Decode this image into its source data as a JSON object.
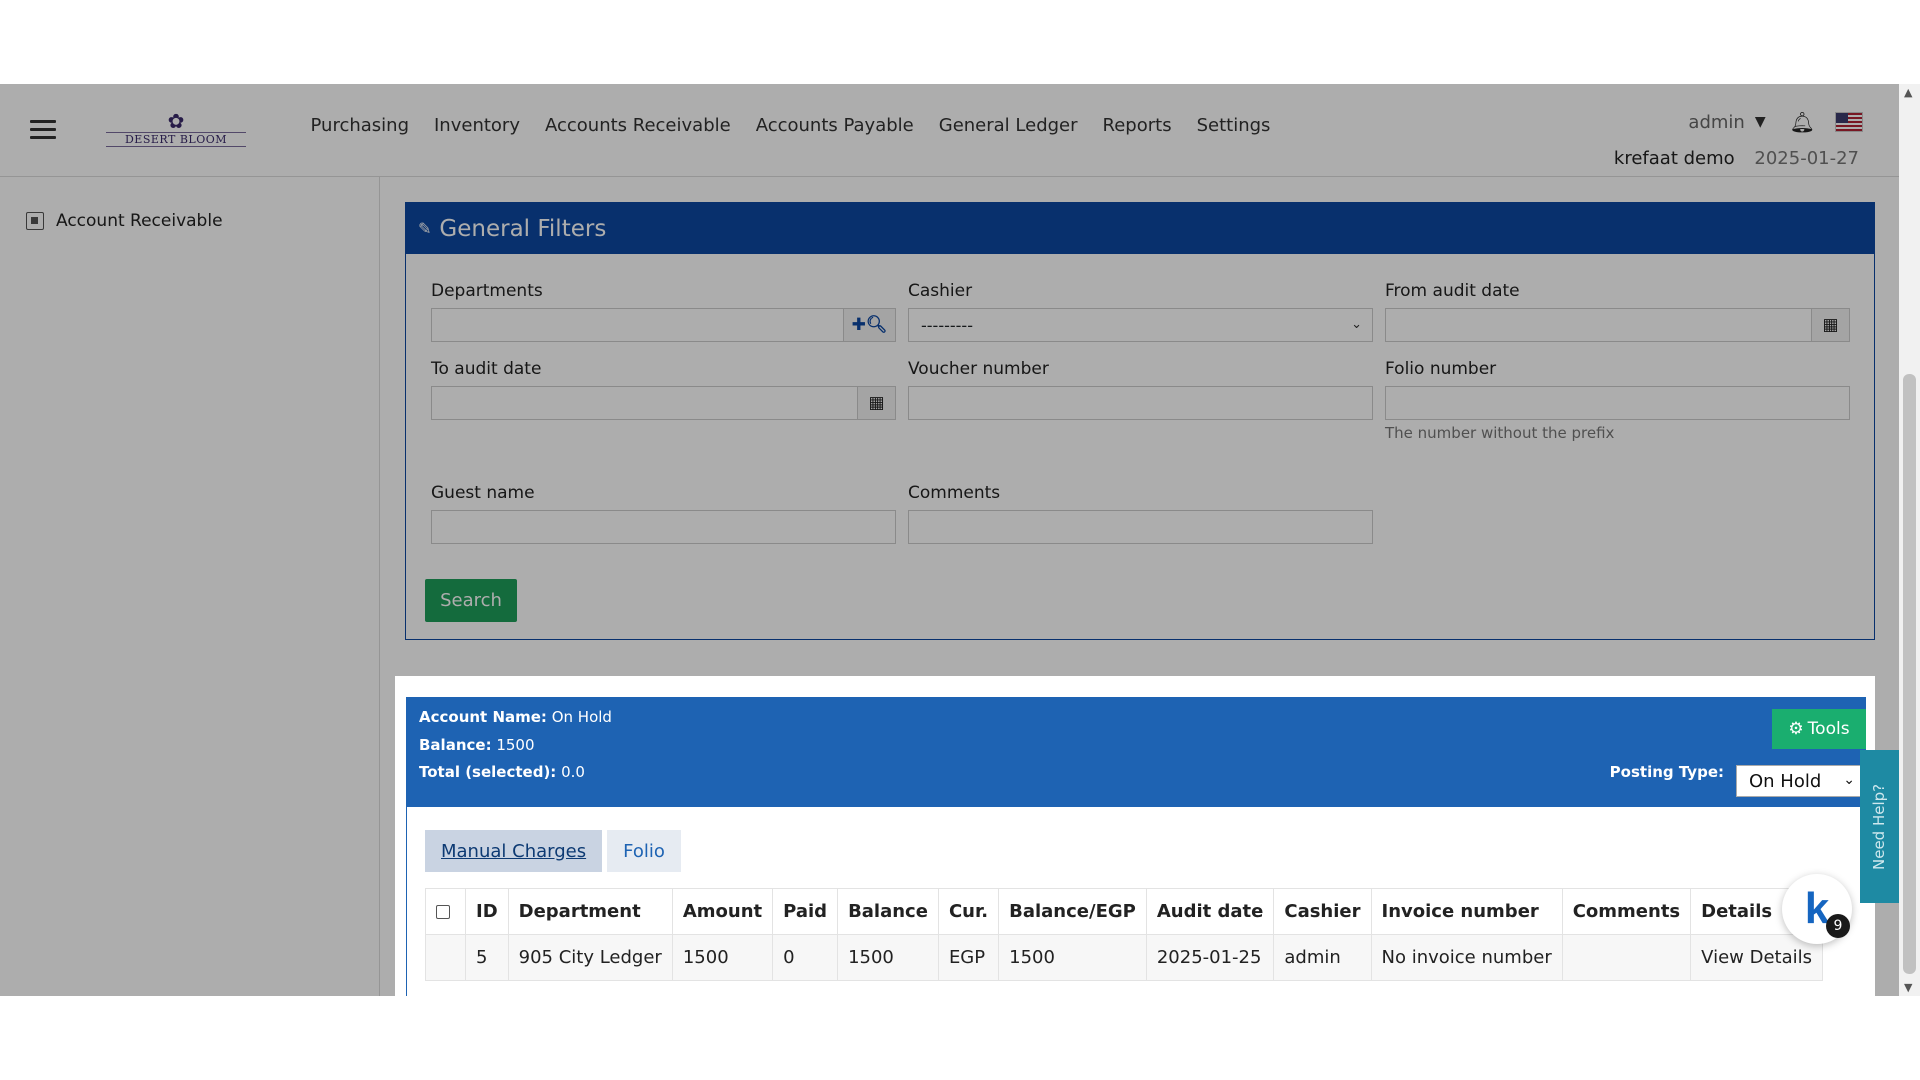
{
  "navbar": {
    "brand": "DESERT BLOOM",
    "menu": [
      "Purchasing",
      "Inventory",
      "Accounts Receivable",
      "Accounts Payable",
      "General Ledger",
      "Reports",
      "Settings"
    ],
    "user": "admin",
    "hotel_name": "krefaat demo",
    "business_date": "2025-01-27"
  },
  "sidebar": {
    "item": "Account Receivable"
  },
  "filters": {
    "title": "General Filters",
    "departments_label": "Departments",
    "cashier_label": "Cashier",
    "cashier_value": "---------",
    "from_audit_label": "From audit date",
    "to_audit_label": "To audit date",
    "voucher_label": "Voucher number",
    "folio_label": "Folio number",
    "folio_help": "The number without the prefix",
    "guest_label": "Guest name",
    "comments_label": "Comments",
    "search_button": "Search"
  },
  "account": {
    "name_label": "Account Name:",
    "name_value": "On Hold",
    "balance_label": "Balance:",
    "balance_value": "1500",
    "total_label": "Total (selected):",
    "total_value": "0.0",
    "tools_button": "Tools",
    "posting_type_label": "Posting Type:",
    "posting_type_value": "On Hold"
  },
  "tabs": [
    "Manual Charges",
    "Folio"
  ],
  "table": {
    "headers": [
      "ID",
      "Department",
      "Amount",
      "Paid",
      "Balance",
      "Cur.",
      "Balance/EGP",
      "Audit date",
      "Cashier",
      "Invoice number",
      "Comments",
      "Details"
    ],
    "rows": [
      [
        "5",
        "905 City Ledger",
        "1500",
        "0",
        "1500",
        "EGP",
        "1500",
        "2025-01-25",
        "admin",
        "No invoice number",
        "",
        "View Details"
      ]
    ]
  },
  "help_tab": "Need Help?",
  "chat": {
    "logo": "k",
    "badge": "9"
  },
  "colors": {
    "filters_header": "#0d47a1",
    "account_header": "#1e63b3",
    "search_button": "#1e9e5a",
    "tools_button": "#1aae6f"
  }
}
